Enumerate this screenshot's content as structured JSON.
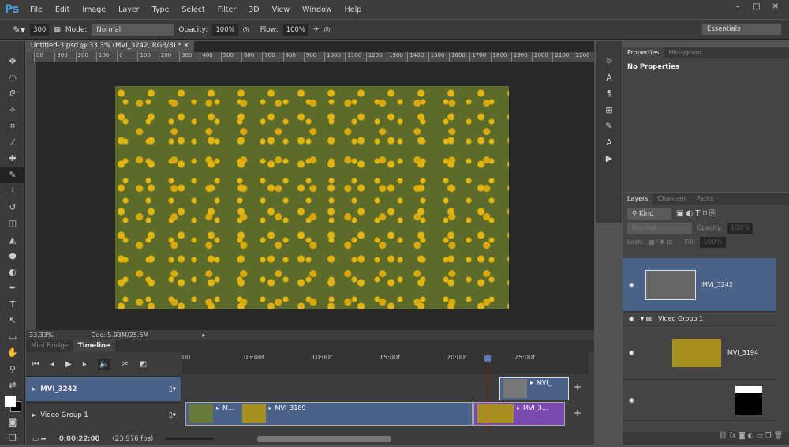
{
  "app": {
    "logo": "Ps",
    "menu": [
      "File",
      "Edit",
      "Image",
      "Layer",
      "Type",
      "Select",
      "Filter",
      "3D",
      "View",
      "Window",
      "Help"
    ],
    "window_controls": [
      "–",
      "□",
      "✕"
    ]
  },
  "options": {
    "brush_size": "300",
    "mode_label": "Mode:",
    "mode": "Normal",
    "opacity_label": "Opacity:",
    "opacity": "100%",
    "flow_label": "Flow:",
    "flow": "100%",
    "workspace": "Essentials"
  },
  "document": {
    "tab": "Untitled-3.psd @ 33.3% (MVI_3242, RGB/8) *",
    "ruler": [
      "00",
      "300",
      "200",
      "100",
      "0",
      "100",
      "200",
      "300",
      "400",
      "500",
      "600",
      "700",
      "800",
      "900",
      "1000",
      "1100",
      "1200",
      "1300",
      "1400",
      "1500",
      "1600",
      "1700",
      "1800",
      "1900",
      "2000",
      "2100",
      "2200"
    ],
    "zoom": "33.33%",
    "doc_size": "Doc: 5.93M/25.6M"
  },
  "timeline": {
    "tabs": [
      "Mini Bridge",
      "Timeline"
    ],
    "ticks": [
      "00",
      "05:00f",
      "10:00f",
      "15:00f",
      "20:00f",
      "25:00f"
    ],
    "tracks": [
      "MVI_3242",
      "Video Group 1"
    ],
    "clips": {
      "top": "MVI_",
      "c1": "M...",
      "c2": "MVI_3189",
      "c3": "MVI_3..."
    },
    "current_time": "0:00:22:08",
    "fps": "(23.976 fps)"
  },
  "properties": {
    "tabs": [
      "Properties",
      "Histogram"
    ],
    "message": "No Properties"
  },
  "layers": {
    "tabs": [
      "Layers",
      "Channels",
      "Paths"
    ],
    "filter": "Kind",
    "blend": "Normal",
    "opacity_label": "Opacity:",
    "opacity": "100%",
    "lock_label": "Lock:",
    "fill_label": "Fill:",
    "fill": "100%",
    "items": [
      "MVI_3242",
      "Video Group 1",
      "MVI_3194"
    ]
  }
}
